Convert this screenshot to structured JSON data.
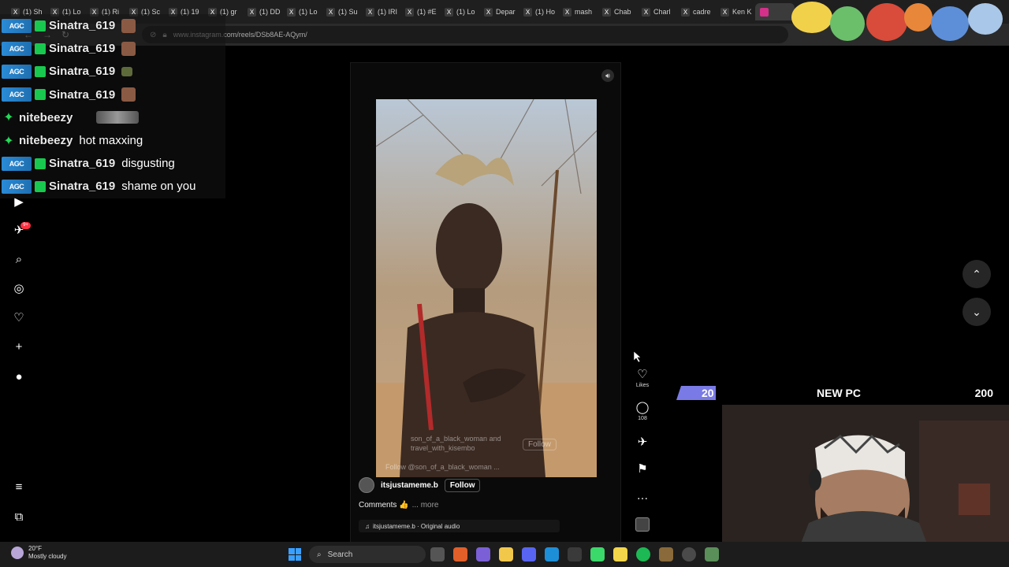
{
  "browser": {
    "tabs": [
      "(1) Sh",
      "(1) Lo",
      "(1) Ri",
      "(1) Sc",
      "(1) 19",
      "(1) gr",
      "(1) DD",
      "(1) Lo",
      "(1) Su",
      "(1) IRI",
      "(1) #E",
      "(1) Lo",
      "Depar",
      "(1) Ho",
      "mash",
      "Chab",
      "Charl",
      "cadre",
      "Ken K"
    ],
    "url": "www.instagram.com/reels/DSb8AE-AQym/"
  },
  "chat": [
    {
      "user": "Sinatra_619",
      "message": "",
      "emote": "face",
      "icon": "badge"
    },
    {
      "user": "Sinatra_619",
      "message": "",
      "emote": "face",
      "icon": "badge"
    },
    {
      "user": "Sinatra_619",
      "message": "",
      "emote": "small",
      "icon": "badge"
    },
    {
      "user": "Sinatra_619",
      "message": "",
      "emote": "face",
      "icon": "badge"
    },
    {
      "user": "nitebeezy",
      "message": "",
      "emote": "wide",
      "icon": "star"
    },
    {
      "user": "nitebeezy",
      "message": "hot maxxing",
      "emote": "",
      "icon": "star"
    },
    {
      "user": "Sinatra_619",
      "message": "disgusting",
      "emote": "",
      "icon": "badge"
    },
    {
      "user": "Sinatra_619",
      "message": "shame on you",
      "emote": "",
      "icon": "badge"
    }
  ],
  "chat_badge_text": "AGC",
  "rail": {
    "notification_badge": "9+"
  },
  "reel": {
    "owner": "itsjustameme.b",
    "follow_label": "Follow",
    "caption": "Comments 👍",
    "more_label": "... more",
    "audio": "itsjustameme.b · Original audio",
    "video_overlay": {
      "credit_line1": "son_of_a_black_woman and",
      "credit_line2": "travel_with_kisembo",
      "follow_ghost": "Follow",
      "follow_caption": "Follow @son_of_a_black_woman ..."
    }
  },
  "actions": {
    "likes_label": "Likes",
    "comments_count": "108"
  },
  "goal": {
    "current": "20",
    "title": "NEW PC",
    "target": "200",
    "progress": 0.1,
    "color": "#7a7ae6"
  },
  "taskbar": {
    "temperature": "20°F",
    "weather": "Mostly cloudy",
    "search": "Search"
  }
}
